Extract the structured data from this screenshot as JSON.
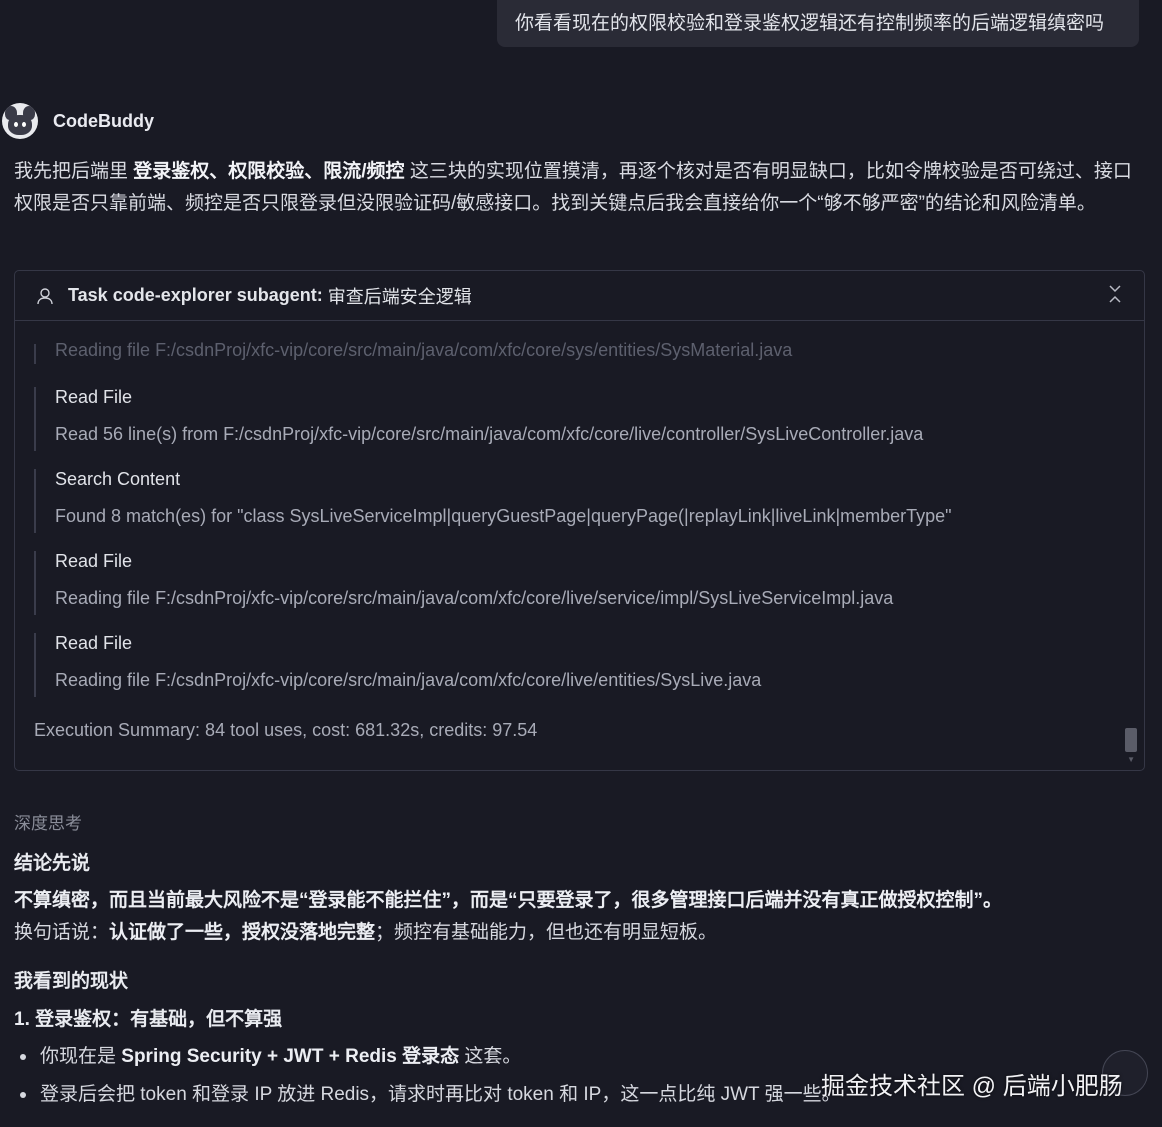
{
  "user_message": "你看看现在的权限校验和登录鉴权逻辑还有控制频率的后端逻辑缜密吗",
  "assistant": {
    "name": "CodeBuddy",
    "intro": {
      "p1": "我先把后端里 ",
      "b1": "登录鉴权、权限校验、限流/频控",
      "p2": " 这三块的实现位置摸清，再逐个核对是否有明显缺口，比如令牌校验是否可绕过、接口权限是否只靠前端、频控是否只限登录但没限验证码/敏感接口。找到关键点后我会直接给你一个“够不够严密”的结论和风险清单。"
    }
  },
  "task": {
    "label": "Task code-explorer subagent:",
    "title": "审查后端安全逻辑",
    "faded_line": "Reading file F:/csdnProj/xfc-vip/core/src/main/java/com/xfc/core/sys/entities/SysMaterial.java",
    "entries": [
      {
        "title": "Read File",
        "desc": "Read 56 line(s) from F:/csdnProj/xfc-vip/core/src/main/java/com/xfc/core/live/controller/SysLiveController.java"
      },
      {
        "title": "Search Content",
        "desc": "Found 8 match(es) for \"class SysLiveServiceImpl|queryGuestPage|queryPage(|replayLink|liveLink|memberType\""
      },
      {
        "title": "Read File",
        "desc": "Reading file F:/csdnProj/xfc-vip/core/src/main/java/com/xfc/core/live/service/impl/SysLiveServiceImpl.java"
      },
      {
        "title": "Read File",
        "desc": "Reading file F:/csdnProj/xfc-vip/core/src/main/java/com/xfc/core/live/entities/SysLive.java"
      }
    ],
    "summary": "Execution Summary: 84 tool uses, cost: 681.32s, credits: 97.54"
  },
  "response": {
    "thinking_label": "深度思考",
    "conclusion_heading": "结论先说",
    "line1": "不算缜密，而且当前最大风险不是“登录能不能拦住”，而是“只要登录了，很多管理接口后端并没有真正做授权控制”。",
    "line2_prefix": "换句话说：",
    "line2_bold": "认证做了一些，授权没落地完整",
    "line2_suffix": "；频控有基础能力，但也还有明显短板。",
    "status_heading": "我看到的现状",
    "point1_heading": "1. 登录鉴权：有基础，但不算强",
    "bullet1_prefix": "你现在是 ",
    "bullet1_bold": "Spring Security + JWT + Redis 登录态",
    "bullet1_suffix": " 这套。",
    "bullet2": "登录后会把 token 和登录 IP 放进 Redis，请求时再比对 token 和 IP，这一点比纯 JWT 强一些。"
  },
  "watermark": "掘金技术社区 @ 后端小肥肠",
  "icons": {
    "collapse": "chevrons-collapse-icon",
    "person": "person-icon",
    "scroll": "scroll-bottom-icon"
  }
}
